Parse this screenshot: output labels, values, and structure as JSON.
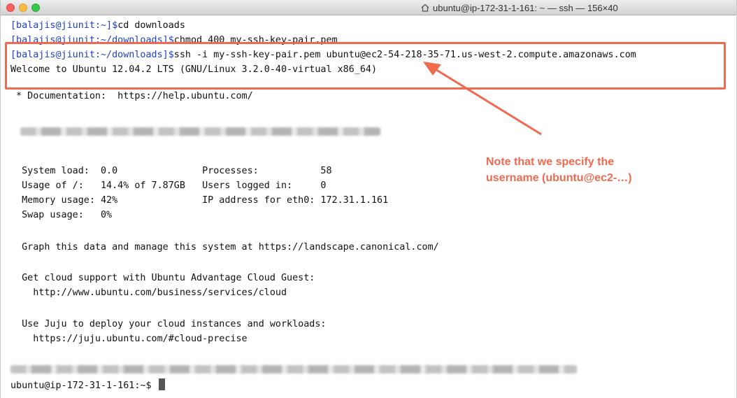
{
  "window": {
    "title": "ubuntu@ip-172-31-1-161: ~ — ssh — 156×40",
    "title_icon": "home-icon"
  },
  "terminal": {
    "lines": [
      {
        "prompt": "[balajis@jiunit:~]$",
        "command": "cd downloads"
      },
      {
        "prompt": "[balajis@jiunit:~/downloads]$",
        "command": "chmod 400 my-ssh-key-pair.pem"
      },
      {
        "prompt": "[balajis@jiunit:~/downloads]$",
        "command": "ssh -i my-ssh-key-pair.pem ubuntu@ec2-54-218-35-71.us-west-2.compute.amazonaws.com"
      },
      {
        "text": "Welcome to Ubuntu 12.04.2 LTS (GNU/Linux 3.2.0-40-virtual x86_64)"
      },
      {
        "text": " * Documentation:  https://help.ubuntu.com/"
      },
      {
        "text": "  System load:  0.0               Processes:           58"
      },
      {
        "text": "  Usage of /:   14.4% of 7.87GB   Users logged in:     0"
      },
      {
        "text": "  Memory usage: 42%               IP address for eth0: 172.31.1.161"
      },
      {
        "text": "  Swap usage:   0%"
      },
      {
        "text": "  Graph this data and manage this system at https://landscape.canonical.com/"
      },
      {
        "text": "  Get cloud support with Ubuntu Advantage Cloud Guest:"
      },
      {
        "text": "    http://www.ubuntu.com/business/services/cloud"
      },
      {
        "text": "  Use Juju to deploy your cloud instances and workloads:"
      },
      {
        "text": "    https://juju.ubuntu.com/#cloud-precise"
      },
      {
        "text": "ubuntu@ip-172-31-1-161:~$ "
      }
    ]
  },
  "annotation": {
    "line1": "Note that we specify the",
    "line2": "username (ubuntu@ec2-…)",
    "color": "#ef6a4f"
  }
}
